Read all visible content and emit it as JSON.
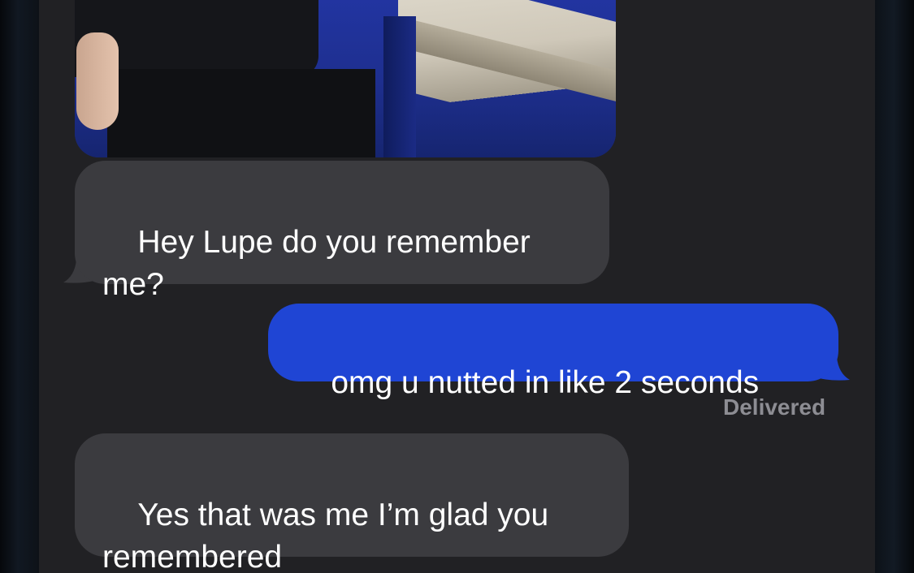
{
  "conversation": {
    "messages": [
      {
        "direction": "incoming",
        "text": "Hey Lupe do you remember me?"
      },
      {
        "direction": "outgoing",
        "text": "omg u nutted in like 2 seconds"
      },
      {
        "direction": "incoming",
        "text": "Yes that was me I’m glad you remembered"
      }
    ],
    "delivery_status": "Delivered"
  },
  "colors": {
    "incoming_bubble": "#3b3b3f",
    "outgoing_bubble": "#1f45d4",
    "thread_background": "#212124"
  }
}
